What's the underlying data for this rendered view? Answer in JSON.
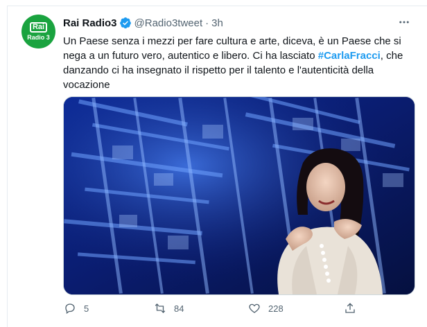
{
  "account": {
    "name": "Rai Radio3",
    "handle": "@Radio3tweet",
    "separator": "·",
    "time": "3h",
    "avatar_top": "Rai",
    "avatar_bottom": "Radio 3"
  },
  "tweet": {
    "text_before": "Un Paese senza i mezzi per fare cultura e arte, diceva, è un Paese che si nega a un futuro vero, autentico e libero. Ci ha lasciato ",
    "hashtag": "#CarlaFracci",
    "text_after": ", che danzando ci ha insegnato il rispetto per il talento e l'autenticità della vocazione"
  },
  "actions": {
    "replies": "5",
    "retweets": "84",
    "likes": "228"
  },
  "icons": {
    "verified": "verified-badge-icon",
    "more": "more-options-icon",
    "reply": "reply-icon",
    "retweet": "retweet-icon",
    "like": "heart-icon",
    "share": "share-icon"
  },
  "colors": {
    "accent": "#1d9bf0",
    "muted": "#536471",
    "avatar_bg": "#1aa33f"
  }
}
